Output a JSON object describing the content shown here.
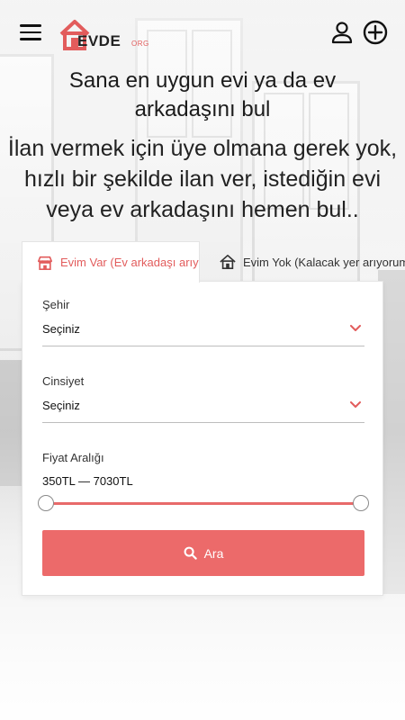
{
  "header": {
    "logo_text": "EVDE",
    "logo_suffix": "ORG",
    "menu_icon": "hamburger-menu-icon",
    "user_icon": "user-icon",
    "add_icon": "add-circle-icon"
  },
  "hero": {
    "title": "Sana en uygun evi ya da ev arkadaşını bul",
    "subtitle": "İlan vermek için üye olmana gerek yok, hızlı bir şekilde ilan ver, istediğin evi veya ev arkadaşını hemen bul.."
  },
  "tabs": [
    {
      "label": "Evim Var (Ev arkadaşı arıyorum)",
      "icon": "store-icon",
      "active": true
    },
    {
      "label": "Evim Yok (Kalacak yer arıyorum)",
      "icon": "house-icon",
      "active": false
    }
  ],
  "form": {
    "city": {
      "label": "Şehir",
      "value": "Seçiniz"
    },
    "gender": {
      "label": "Cinsiyet",
      "value": "Seçiniz"
    },
    "price": {
      "label": "Fiyat Aralığı",
      "value": "350TL — 7030TL",
      "range_min": 350,
      "range_max": 7030
    },
    "search_label": "Ara"
  },
  "colors": {
    "accent": "#ec6a6a",
    "accent_text": "#e25c5c",
    "text": "#1a1a1a"
  }
}
